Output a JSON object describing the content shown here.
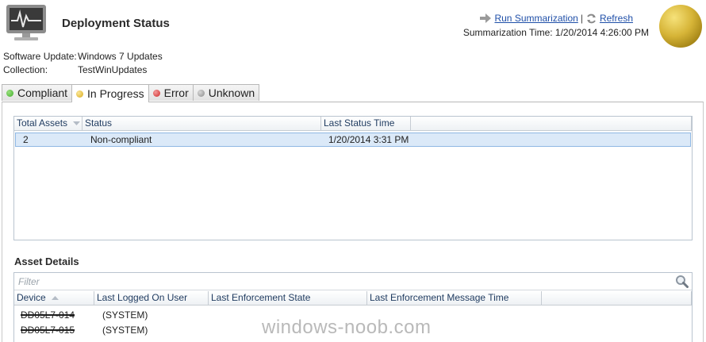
{
  "header": {
    "title": "Deployment Status",
    "run_summarization": "Run Summarization",
    "separator": "|",
    "refresh": "Refresh",
    "summarization_time": "Summarization Time: 1/20/2014 4:26:00 PM"
  },
  "info": {
    "software_update_label": "Software Update:",
    "software_update_value": "Windows 7 Updates",
    "collection_label": "Collection:",
    "collection_value": "TestWinUpdates"
  },
  "tabs": [
    {
      "label": "Compliant",
      "color": "#3fae2a"
    },
    {
      "label": "In Progress",
      "color": "#e8c22a",
      "active": true
    },
    {
      "label": "Error",
      "color": "#d93a3a"
    },
    {
      "label": "Unknown",
      "color": "#9a9a9a"
    }
  ],
  "status_grid": {
    "columns": [
      "Total Assets",
      "Status",
      "Last Status Time"
    ],
    "rows": [
      {
        "total": "2",
        "status": "Non-compliant",
        "time": "1/20/2014 3:31 PM"
      }
    ]
  },
  "asset_details": {
    "title": "Asset Details",
    "filter_placeholder": "Filter",
    "columns": [
      "Device",
      "Last Logged On User",
      "Last Enforcement State",
      "Last Enforcement Message Time"
    ],
    "rows": [
      {
        "device": "DD05L7-014",
        "user": "(SYSTEM)"
      },
      {
        "device": "DD05L7-015",
        "user": "(SYSTEM)"
      }
    ]
  },
  "watermark": "windows-noob.com",
  "colors": {
    "link": "#1f4fa8",
    "selection": "#dbe9f8",
    "status_orb": "#c9a62c"
  }
}
